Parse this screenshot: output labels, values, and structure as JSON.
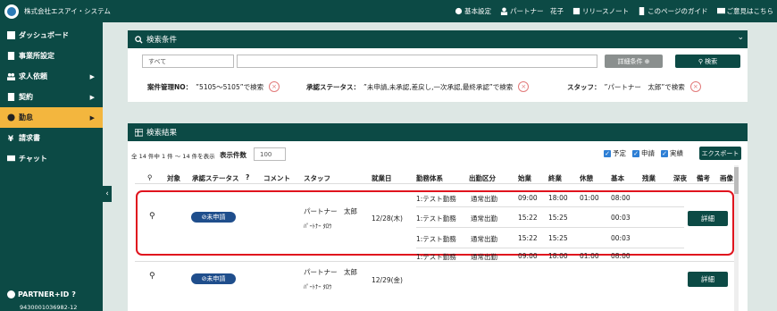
{
  "header": {
    "company": "株式会社エスアイ・システム",
    "nav": [
      {
        "icon": "gear-icon",
        "label": "基本設定"
      },
      {
        "icon": "user-icon",
        "label": "パートナー　花子"
      },
      {
        "icon": "calendar-icon",
        "label": "リリースノート"
      },
      {
        "icon": "document-icon",
        "label": "このページのガイド"
      },
      {
        "icon": "chat-icon",
        "label": "ご意見はこちら"
      }
    ]
  },
  "sidebar": {
    "items": [
      {
        "icon": "dashboard-icon",
        "label": "ダッシュボード"
      },
      {
        "icon": "building-icon",
        "label": "事業所設定"
      },
      {
        "icon": "people-icon",
        "label": "求人依頼",
        "arrow": "▶"
      },
      {
        "icon": "file-icon",
        "label": "契約",
        "arrow": "▶"
      },
      {
        "icon": "clock-icon",
        "label": "勤怠",
        "arrow": "▶"
      },
      {
        "icon": "yen-icon",
        "label": "請求書"
      },
      {
        "icon": "chat-icon",
        "label": "チャット"
      }
    ],
    "collapse": "‹",
    "partner_label": "PARTNER+ID",
    "partner_id": "9430001036982-12"
  },
  "search": {
    "title": "検索条件",
    "chevron": "⌄",
    "select_value": "すべて",
    "input_value": "",
    "advanced_label": "詳細条件 ⊕",
    "search_label": "検索",
    "conditions": [
      {
        "label": "案件管理NO：",
        "value": "”5105～5105”で検索"
      },
      {
        "label": "承認ステータス：",
        "value": "”未申請,未承認,差戻し,一次承認,最終承認”で検索"
      },
      {
        "label": "スタッフ：",
        "value": "”パートナー　太郎”で検索"
      }
    ],
    "clear": "×"
  },
  "results": {
    "title": "検索結果",
    "summary": "全 14 件中 1 件 ～ 14 件を表示",
    "per_page_label": "表示件数",
    "per_page": "100",
    "checks": [
      "予定",
      "申請",
      "実績"
    ],
    "export": "エクスポート",
    "columns": [
      "対象",
      "承認ステータス",
      "コメント",
      "スタッフ",
      "就業日",
      "勤務体系",
      "出勤区分",
      "始業",
      "終業",
      "休憩",
      "基本",
      "残業",
      "深夜",
      "備考",
      "画像"
    ],
    "rows": [
      {
        "status": "⊘未申請",
        "staff": "パートナー　太郎",
        "kana": "ﾊﾟｰﾄﾅｰ ﾀﾛｳ",
        "date": "12/28(木)",
        "detail": "詳細",
        "lines": [
          {
            "type": "1:テスト勤務",
            "cat": "通常出勤",
            "start": "09:00",
            "end": "18:00",
            "break": "01:00",
            "basic": "08:00"
          },
          {
            "type": "1:テスト勤務",
            "cat": "通常出勤",
            "start": "15:22",
            "end": "15:25",
            "break": "",
            "basic": "00:03"
          },
          {
            "type": "1:テスト勤務",
            "cat": "通常出勤",
            "start": "15:22",
            "end": "15:25",
            "break": "",
            "basic": "00:03"
          }
        ]
      },
      {
        "status": "⊘未申請",
        "staff": "パートナー　太郎",
        "kana": "ﾊﾟｰﾄﾅｰ ﾀﾛｳ",
        "date": "12/29(金)",
        "detail": "詳細",
        "lines": [
          {
            "type": "1:テスト勤務",
            "cat": "通常出勤",
            "start": "09:00",
            "end": "18:00",
            "break": "01:00",
            "basic": "08:00"
          }
        ]
      }
    ]
  }
}
